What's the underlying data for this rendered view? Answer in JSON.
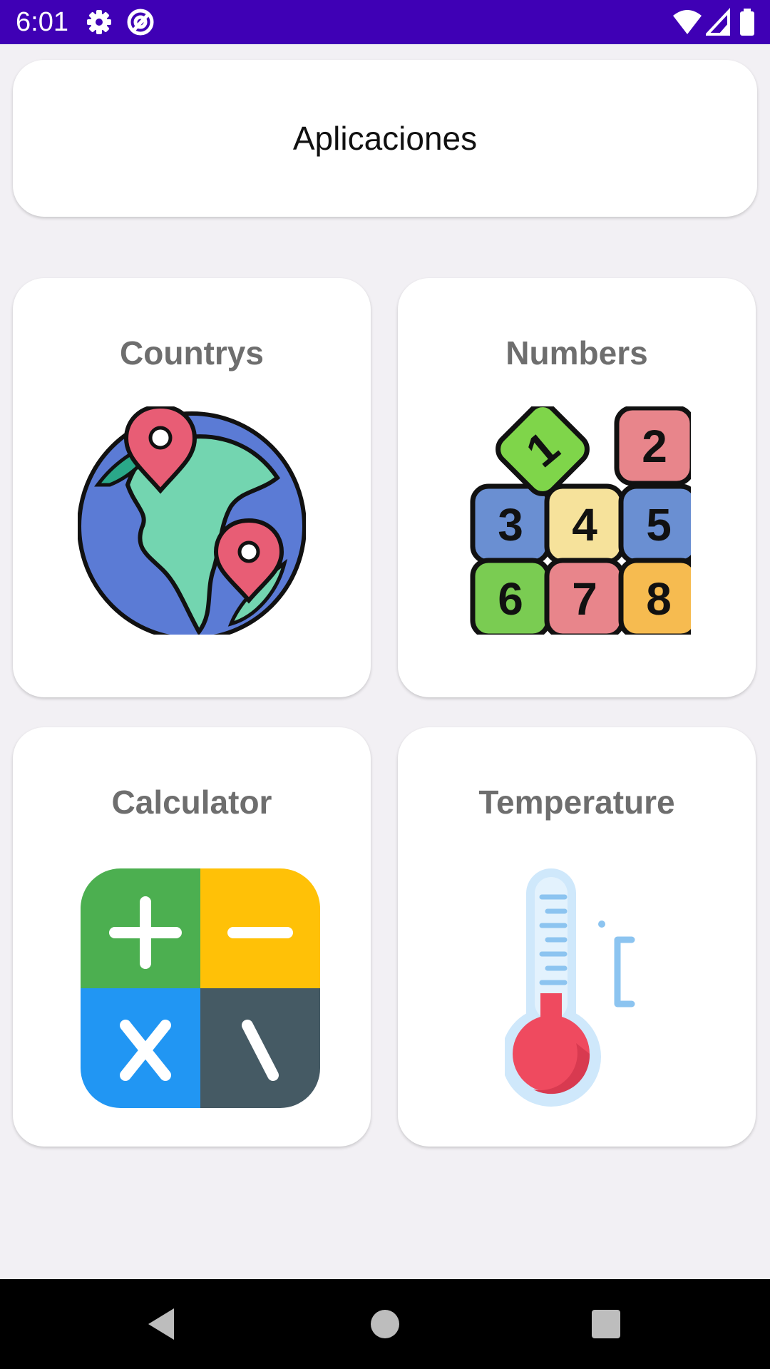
{
  "status_bar": {
    "time": "6:01",
    "background": "#3f00b5",
    "left_icons": [
      "gear-icon",
      "at-sign-icon"
    ],
    "right_icons": [
      "wifi-icon",
      "signal-icon",
      "battery-icon"
    ]
  },
  "header": {
    "title": "Aplicaciones"
  },
  "apps": [
    {
      "label": "Countrys",
      "icon": "globe-map-pin-icon"
    },
    {
      "label": "Numbers",
      "icon": "number-blocks-icon"
    },
    {
      "label": "Calculator",
      "icon": "calculator-icon"
    },
    {
      "label": "Temperature",
      "icon": "thermometer-icon"
    }
  ],
  "nav_bar": {
    "buttons": [
      "back-icon",
      "home-icon",
      "recents-icon"
    ]
  }
}
